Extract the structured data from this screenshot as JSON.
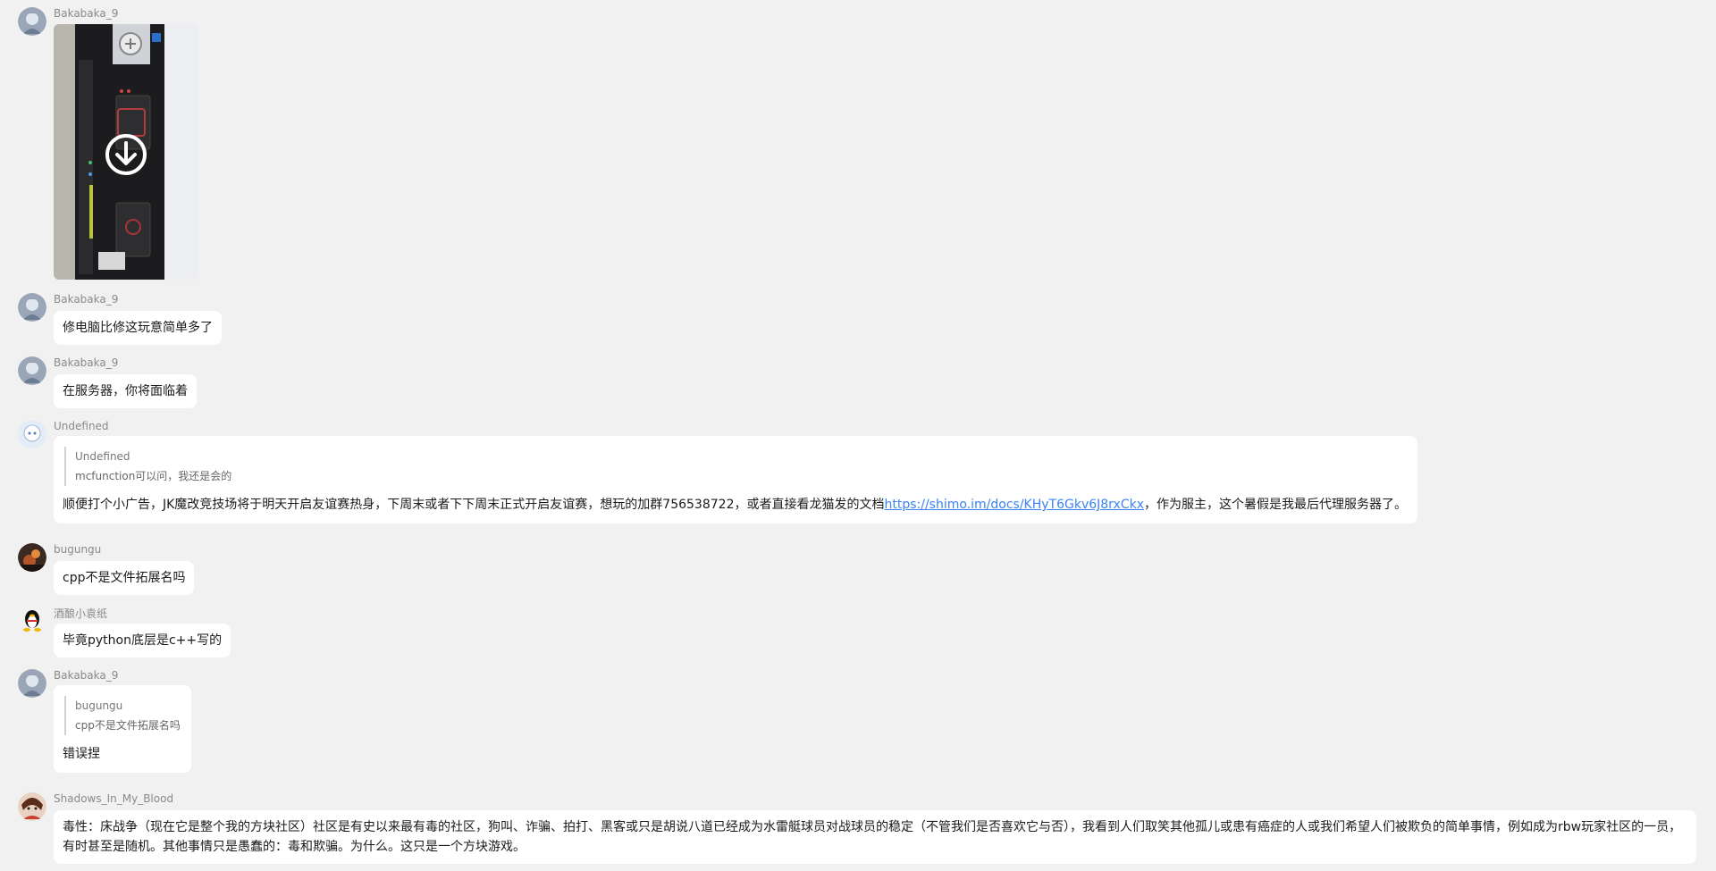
{
  "messages": [
    {
      "sender": "Bakabaka_9",
      "type": "image",
      "image_alt": "server-photo"
    },
    {
      "sender": "Bakabaka_9",
      "text": "修电脑比修这玩意简单多了"
    },
    {
      "sender": "Bakabaka_9",
      "text": "在服务器，你将面临着"
    },
    {
      "sender": "Undefined",
      "quote": {
        "name": "Undefined",
        "text": "mcfunction可以问，我还是会的"
      },
      "text_before": "顺便打个小广告，JK魔改竞技场将于明天开启友谊赛热身，下周末或者下下周末正式开启友谊赛，想玩的加群756538722，或者直接看龙猫发的文档",
      "link": "https://shimo.im/docs/KHyT6Gkv6J8rxCkx",
      "text_after": "，作为服主，这个暑假是我最后代理服务器了。"
    },
    {
      "sender": "bugungu",
      "text": "cpp不是文件拓展名吗"
    },
    {
      "sender": "酒酿小袁纸",
      "text": "毕竟python底层是c++写的"
    },
    {
      "sender": "Bakabaka_9",
      "quote": {
        "name": "bugungu",
        "text": "cpp不是文件拓展名吗"
      },
      "text": "错误捏"
    },
    {
      "sender": "Shadows_In_My_Blood",
      "text": "毒性：床战争（现在它是整个我的方块社区）社区是有史以来最有毒的社区，狗叫、诈骗、拍打、黑客或只是胡说八道已经成为水雷艇球员对战球员的稳定（不管我们是否喜欢它与否），我看到人们取笑其他孤儿或患有癌症的人或我们希望人们被欺负的简单事情，例如成为rbw玩家社区的一员，有时甚至是随机。其他事情只是愚蠢的：毒和欺骗。为什么。这只是一个方块游戏。"
    }
  ],
  "colors": {
    "background": "#f1f1f1",
    "bubble": "#ffffff",
    "link": "#3b82f6",
    "name": "#8a8a8a"
  }
}
